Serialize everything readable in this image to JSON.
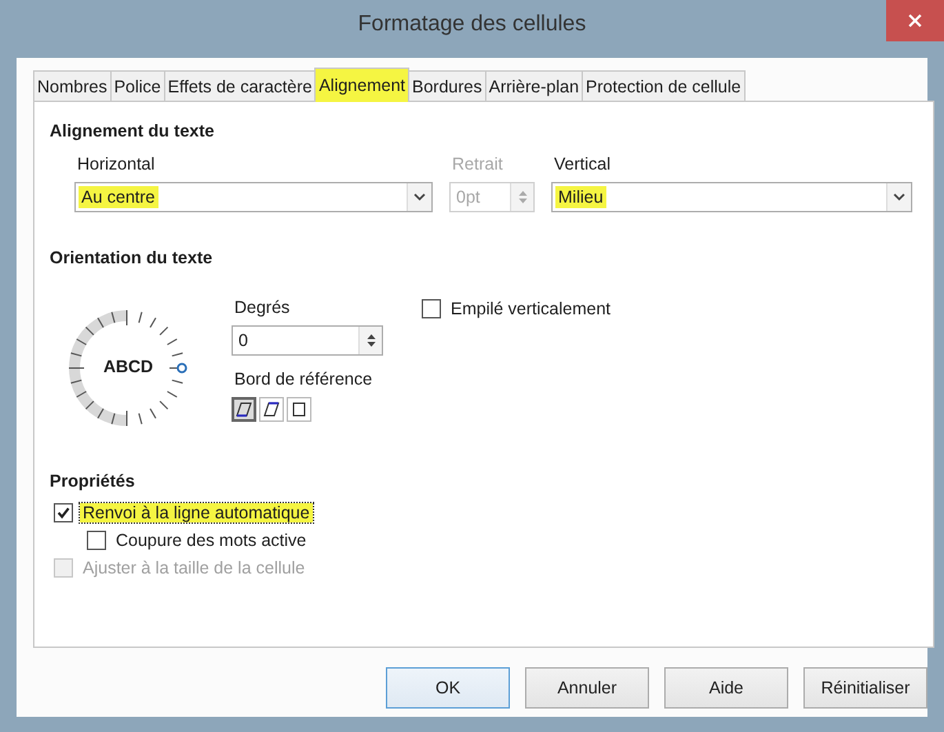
{
  "window": {
    "title": "Formatage des cellules"
  },
  "tabs": [
    {
      "label": "Nombres",
      "selected": false,
      "highlighted": false
    },
    {
      "label": "Police",
      "selected": false,
      "highlighted": false
    },
    {
      "label": "Effets de caractère",
      "selected": false,
      "highlighted": false
    },
    {
      "label": "Alignement",
      "selected": true,
      "highlighted": true
    },
    {
      "label": "Bordures",
      "selected": false,
      "highlighted": false
    },
    {
      "label": "Arrière-plan",
      "selected": false,
      "highlighted": false
    },
    {
      "label": "Protection de cellule",
      "selected": false,
      "highlighted": false
    }
  ],
  "text_alignment": {
    "heading": "Alignement du texte",
    "horizontal": {
      "label": "Horizontal",
      "value": "Au centre",
      "highlighted": true
    },
    "indent": {
      "label": "Retrait",
      "value": "0pt",
      "disabled": true
    },
    "vertical": {
      "label": "Vertical",
      "value": "Milieu",
      "highlighted": true
    }
  },
  "text_orientation": {
    "heading": "Orientation du texte",
    "dial_label": "ABCD",
    "degrees": {
      "label": "Degrés",
      "value": "0"
    },
    "reference_edge": {
      "label": "Bord de référence",
      "options": [
        {
          "kind": "bottom",
          "selected": true
        },
        {
          "kind": "top",
          "selected": false
        },
        {
          "kind": "none",
          "selected": false
        }
      ]
    },
    "stacked": {
      "label": "Empilé verticalement",
      "checked": false
    }
  },
  "properties": {
    "heading": "Propriétés",
    "options": [
      {
        "label": "Renvoi à la ligne automatique",
        "checked": true,
        "disabled": false,
        "highlighted": true,
        "children": [
          {
            "label": "Coupure des mots active",
            "checked": false,
            "disabled": false,
            "highlighted": false
          }
        ]
      },
      {
        "label": "Ajuster à la taille de la cellule",
        "checked": false,
        "disabled": true,
        "highlighted": false
      }
    ]
  },
  "buttons": [
    {
      "label": "OK",
      "default": true
    },
    {
      "label": "Annuler",
      "default": false
    },
    {
      "label": "Aide",
      "default": false
    },
    {
      "label": "Réinitialiser",
      "default": false
    }
  ]
}
